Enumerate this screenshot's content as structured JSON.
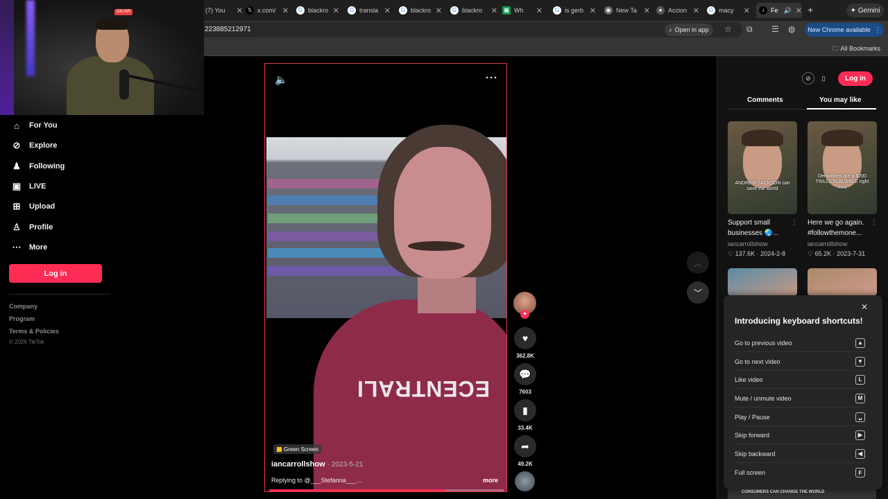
{
  "browser": {
    "tabs": [
      {
        "title": "(7) You",
        "icon": "youtube-icon"
      },
      {
        "title": "x.com/",
        "icon": "x-icon"
      },
      {
        "title": "blackro",
        "icon": "google-icon"
      },
      {
        "title": "transla",
        "icon": "google-icon"
      },
      {
        "title": "blackro",
        "icon": "google-icon"
      },
      {
        "title": "blackro",
        "icon": "google-icon"
      },
      {
        "title": "Wh",
        "icon": "sheets-icon"
      },
      {
        "title": "is gerb",
        "icon": "google-icon"
      },
      {
        "title": "New Ta",
        "icon": "chrome-icon"
      },
      {
        "title": "Accion",
        "icon": "site-icon"
      },
      {
        "title": "macy",
        "icon": "google-icon"
      },
      {
        "title": "Fe",
        "icon": "tiktok-icon"
      }
    ],
    "gemini_label": "Gemini",
    "url": "223885212971",
    "open_in_app": "Open in app",
    "new_chrome": "New Chrome available",
    "all_bookmarks": "All Bookmarks"
  },
  "webcam": {
    "sign": "ON AIR"
  },
  "sidebar": {
    "items": [
      {
        "label": "For You",
        "icon": "home-icon"
      },
      {
        "label": "Explore",
        "icon": "compass-icon"
      },
      {
        "label": "Following",
        "icon": "following-icon"
      },
      {
        "label": "LIVE",
        "icon": "live-icon"
      },
      {
        "label": "Upload",
        "icon": "upload-icon"
      },
      {
        "label": "Profile",
        "icon": "profile-icon"
      },
      {
        "label": "More",
        "icon": "more-dots-icon"
      }
    ],
    "login": "Log in",
    "footer": [
      "Company",
      "Program",
      "Terms & Policies"
    ],
    "copyright": "© 2026 TikTok"
  },
  "video": {
    "badge": "Green Screen",
    "author": "iancarrollshow",
    "date": "· 2023-5-21",
    "description": "Replying to @___Stefanna___...",
    "more": "more",
    "shirt_text": "ECENTRALI",
    "progress": 0.75,
    "actions": {
      "likes": "362.8K",
      "comments": "7603",
      "saves": "33.4K",
      "shares": "49.2K"
    }
  },
  "panel": {
    "login": "Log in",
    "tab_comments": "Comments",
    "tab_you_may_like": "You may like",
    "cards": [
      {
        "title": "Support small businesses 🌏...",
        "author": "iancarrollshow",
        "likes": "137.6K",
        "date": "2024-2-8",
        "caption": "ANDREW JACKSON can save the world"
      },
      {
        "title": "Here we go again. #followthemone...",
        "author": "iancarrollshow",
        "likes": "65.2K",
        "date": "2023-7-31",
        "caption": "Derivatives are a $200 TRILLION BUBBLE right now"
      }
    ],
    "bottom_caption": "CONSUMERS CAN CHANGE THE WORLD"
  },
  "shortcuts": {
    "title": "Introducing keyboard shortcuts!",
    "rows": [
      {
        "label": "Go to previous video",
        "key": "▲"
      },
      {
        "label": "Go to next video",
        "key": "▼"
      },
      {
        "label": "Like video",
        "key": "L"
      },
      {
        "label": "Mute / unmute video",
        "key": "M"
      },
      {
        "label": "Play / Pause",
        "key": "␣"
      },
      {
        "label": "Skip forward",
        "key": "▶"
      },
      {
        "label": "Skip backward",
        "key": "◀"
      },
      {
        "label": "Full screen",
        "key": "F"
      }
    ]
  }
}
